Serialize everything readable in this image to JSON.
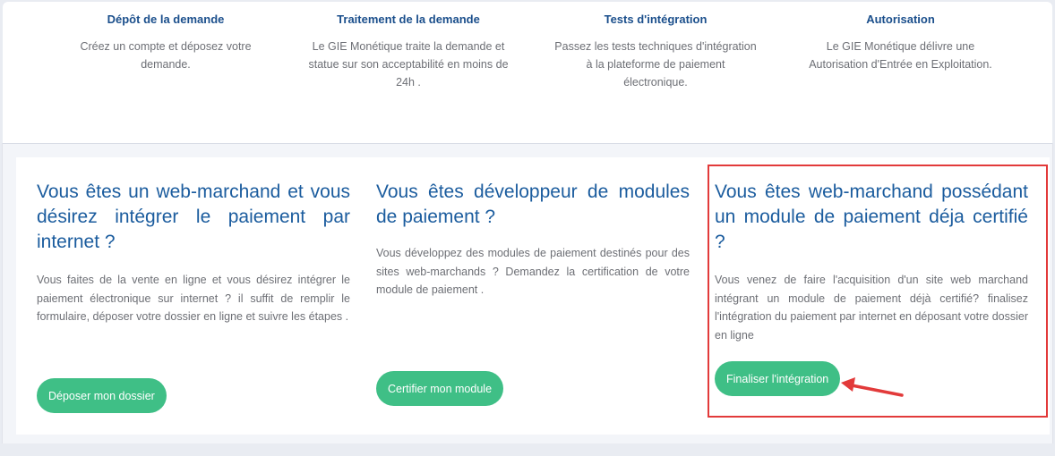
{
  "steps": [
    {
      "title": "Dépôt de la demande",
      "lines": [
        "Créez un compte et déposez votre",
        "demande."
      ]
    },
    {
      "title": "Traitement de la demande",
      "lines": [
        "Le GIE Monétique traite la demande et",
        "statue sur son acceptabilité en moins de",
        "24h ."
      ]
    },
    {
      "title": "Tests d'intégration",
      "lines": [
        "Passez les tests techniques d'intégration",
        "à la plateforme de paiement",
        "électronique."
      ]
    },
    {
      "title": "Autorisation",
      "lines": [
        "Le GIE Monétique délivre une",
        "Autorisation d'Entrée en Exploitation."
      ]
    }
  ],
  "cards": [
    {
      "title": "Vous êtes un web-marchand et vous désirez intégrer le paiement par internet ?",
      "text": "Vous faites de  la vente en ligne et  vous désirez intégrer le paiement électronique sur internet ? il suffit de remplir le formulaire, déposer votre dossier en ligne et suivre les étapes .",
      "button": "Déposer mon dossier"
    },
    {
      "title": "Vous êtes développeur de modules de paiement ?",
      "text": "Vous développez des modules de paiement destinés pour des sites  web-marchands ? Demandez la certification de votre module de paiement .",
      "button": "Certifier mon module"
    },
    {
      "title": "Vous êtes web-marchand possédant un module de paiement déja certifié ?",
      "text": "Vous venez de faire l'acquisition d'un site web marchand  intégrant un module de paiement déjà certifié? finalisez l'intégration du paiement par internet en déposant votre dossier en ligne",
      "button": "Finaliser l'intégration"
    }
  ],
  "colors": {
    "title_blue": "#1b5c9e",
    "button_green": "#3fbf86",
    "annotation_red": "#e23a3a"
  }
}
